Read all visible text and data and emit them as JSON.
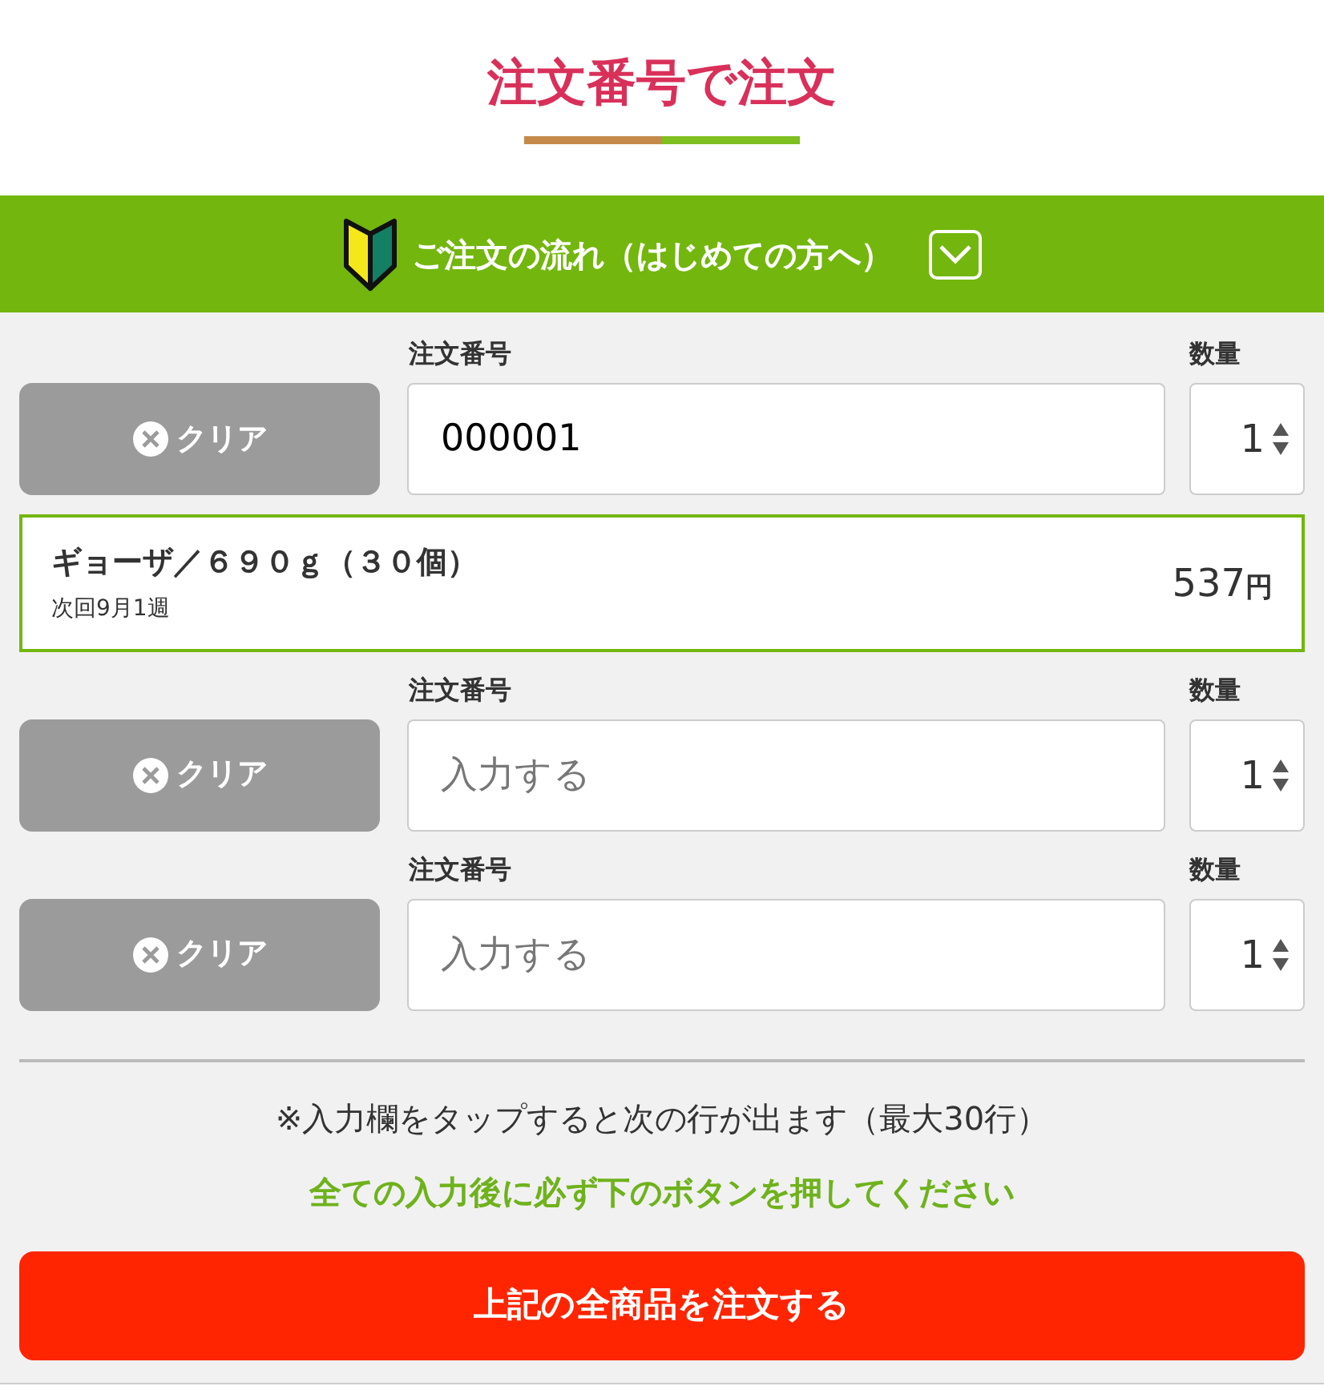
{
  "title": "注文番号で注文",
  "guide": {
    "label": "ご注文の流れ（はじめての方へ）",
    "expanded": false
  },
  "rows": [
    {
      "order_label": "注文番号",
      "quantity_label": "数量",
      "clear_label": "クリア",
      "value": "000001",
      "quantity": "1",
      "product": {
        "name": "ギョーザ／６９０ｇ（３０個）",
        "delivery": "次回9月1週",
        "price": "537",
        "currency": "円"
      }
    },
    {
      "order_label": "注文番号",
      "quantity_label": "数量",
      "clear_label": "クリア",
      "placeholder": "入力する",
      "quantity": "1"
    },
    {
      "order_label": "注文番号",
      "quantity_label": "数量",
      "clear_label": "クリア",
      "placeholder": "入力する",
      "quantity": "1"
    }
  ],
  "note": "※入力欄をタップすると次の行が出ます（最大30行）",
  "warning": "全ての入力後に必ず下のボタンを押してください",
  "submit": "上記の全商品を注文する"
}
